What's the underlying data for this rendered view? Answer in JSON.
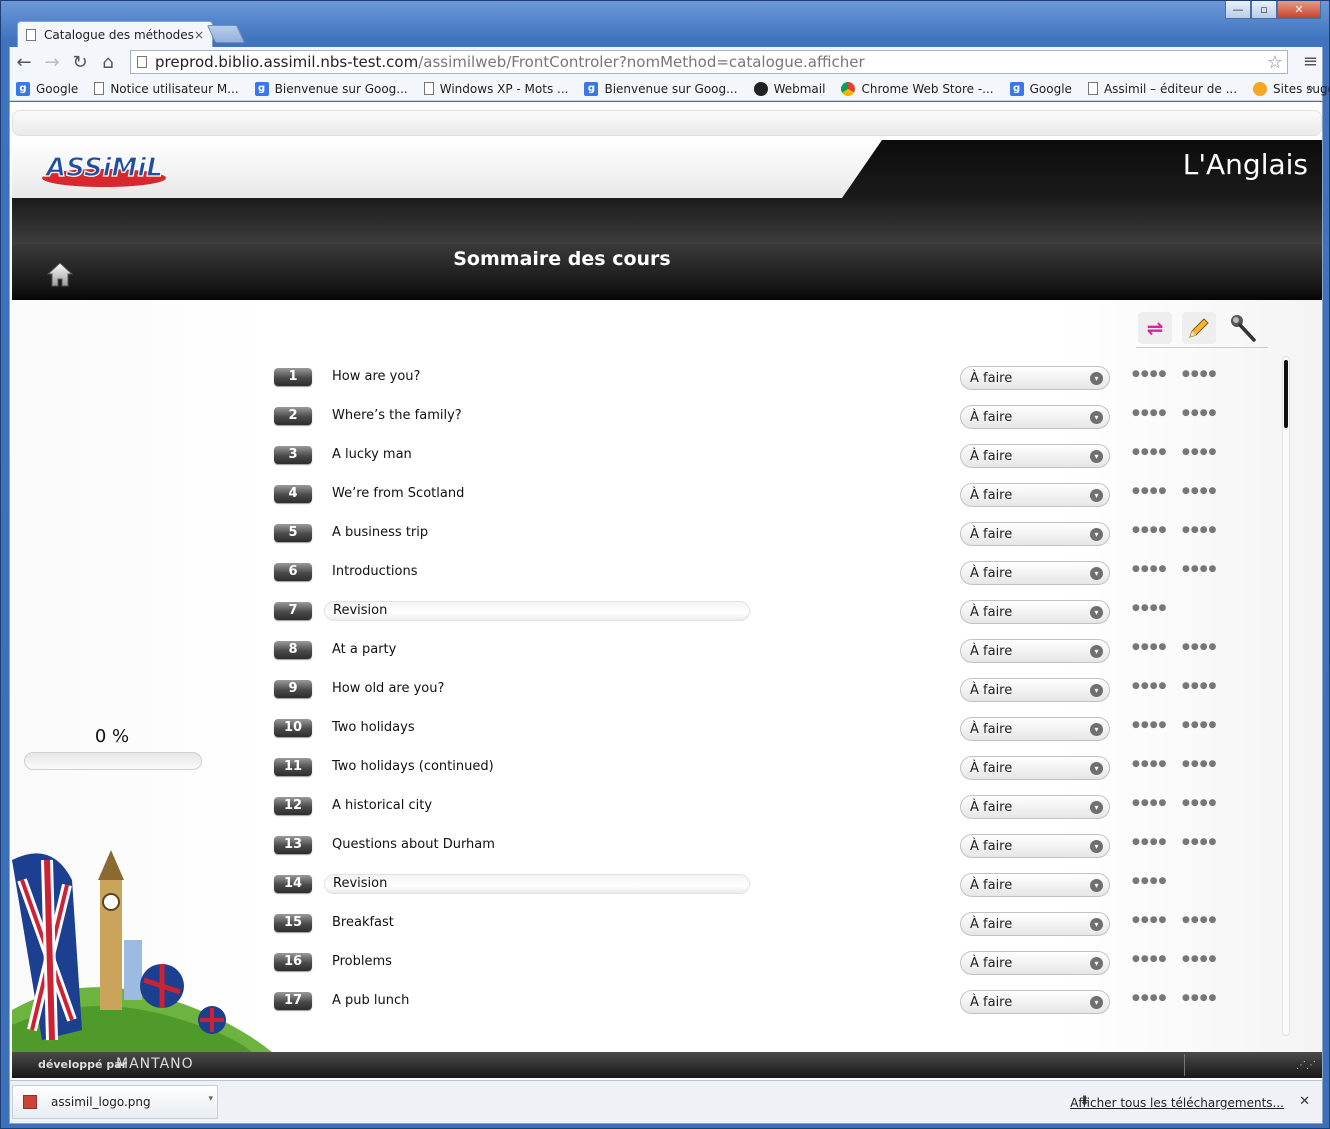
{
  "browser": {
    "tab_title": "Catalogue des méthodes",
    "tab_close": "×",
    "url_host": "preprod.biblio.assimil.nbs-test.com",
    "url_path": "/assimilweb/FrontControler?nomMethod=catalogue.afficher",
    "win_minimize": "—",
    "win_maximize": "▫",
    "win_close": "✕",
    "back": "←",
    "forward": "→",
    "reload": "↻",
    "home": "⌂",
    "star": "☆",
    "menu": "≡",
    "bookmarks_more": "»",
    "bookmarks": [
      {
        "label": "Google",
        "icon": "g"
      },
      {
        "label": "Notice utilisateur M...",
        "icon": "doc"
      },
      {
        "label": "Bienvenue sur Goog...",
        "icon": "g"
      },
      {
        "label": "Windows XP - Mots ...",
        "icon": "doc"
      },
      {
        "label": "Bienvenue sur Goog...",
        "icon": "g"
      },
      {
        "label": "Webmail",
        "icon": "web"
      },
      {
        "label": "Chrome Web Store -...",
        "icon": "chrome"
      },
      {
        "label": "Google",
        "icon": "g"
      },
      {
        "label": "Assimil – éditeur de ...",
        "icon": "doc"
      },
      {
        "label": "Sites suggérés",
        "icon": "sug"
      }
    ]
  },
  "app": {
    "language_title": "L'Anglais",
    "section_title": "Sommaire des cours",
    "progress_label": "0 %",
    "progress_fraction": 0,
    "footer_developed_by": "développé par",
    "footer_brand": "MANTANO",
    "footer_grip": "⋰⋰",
    "lessons": [
      {
        "num": "1",
        "title": "How are you?",
        "status": "À faire",
        "revision": false
      },
      {
        "num": "2",
        "title": "Where’s the family?",
        "status": "À faire",
        "revision": false
      },
      {
        "num": "3",
        "title": "A lucky man",
        "status": "À faire",
        "revision": false
      },
      {
        "num": "4",
        "title": "We’re from Scotland",
        "status": "À faire",
        "revision": false
      },
      {
        "num": "5",
        "title": "A business trip",
        "status": "À faire",
        "revision": false
      },
      {
        "num": "6",
        "title": "Introductions",
        "status": "À faire",
        "revision": false
      },
      {
        "num": "7",
        "title": "Revision",
        "status": "À faire",
        "revision": true
      },
      {
        "num": "8",
        "title": "At a party",
        "status": "À faire",
        "revision": false
      },
      {
        "num": "9",
        "title": "How old are you?",
        "status": "À faire",
        "revision": false
      },
      {
        "num": "10",
        "title": "Two holidays",
        "status": "À faire",
        "revision": false
      },
      {
        "num": "11",
        "title": "Two holidays (continued)",
        "status": "À faire",
        "revision": false
      },
      {
        "num": "12",
        "title": "A historical city",
        "status": "À faire",
        "revision": false
      },
      {
        "num": "13",
        "title": "Questions about Durham",
        "status": "À faire",
        "revision": false
      },
      {
        "num": "14",
        "title": "Revision",
        "status": "À faire",
        "revision": true
      },
      {
        "num": "15",
        "title": "Breakfast",
        "status": "À faire",
        "revision": false
      },
      {
        "num": "16",
        "title": "Problems",
        "status": "À faire",
        "revision": false
      },
      {
        "num": "17",
        "title": "A pub lunch",
        "status": "À faire",
        "revision": false
      }
    ],
    "dots": "●●●●",
    "chevron": "▾",
    "swap_glyph": "⇌"
  },
  "downloads": {
    "file_name": "assimil_logo.png",
    "file_arrow": "▾",
    "show_all": "Afficher tous les téléchargements...",
    "show_all_icon": "⬇",
    "close": "✕"
  }
}
